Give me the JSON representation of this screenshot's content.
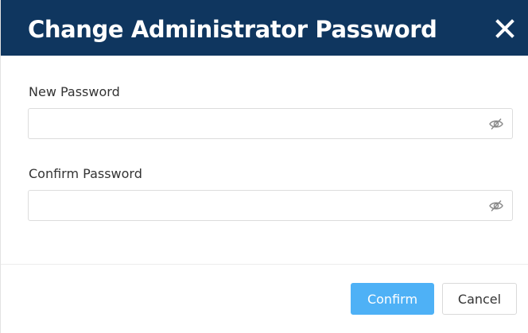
{
  "dialog": {
    "title": "Change Administrator Password",
    "close_icon": "close-icon",
    "header_color": "#0f365f"
  },
  "fields": {
    "new_password": {
      "label": "New Password",
      "value": "",
      "placeholder": "",
      "icon": "eye-slash-icon"
    },
    "confirm_password": {
      "label": "Confirm Password",
      "value": "",
      "placeholder": "",
      "icon": "eye-slash-icon"
    }
  },
  "footer": {
    "confirm_label": "Confirm",
    "cancel_label": "Cancel",
    "confirm_color": "#4eb1f6"
  }
}
